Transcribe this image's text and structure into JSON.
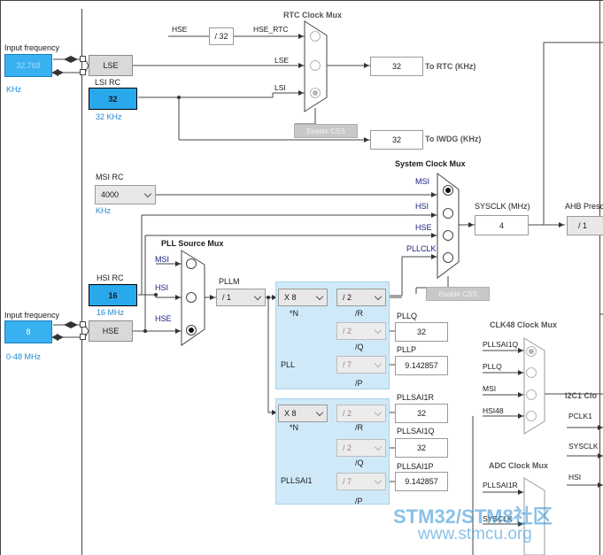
{
  "rtc_mux": {
    "title": "RTC Clock Mux",
    "input_hse": "HSE",
    "input_hse_rtc": "HSE_RTC",
    "input_lse": "LSE",
    "input_lsi": "LSI"
  },
  "hse_rtc_divider": "/ 32",
  "lse_input": {
    "label": "Input frequency",
    "value": "32.768",
    "unit": "KHz"
  },
  "lse_source": "LSE",
  "lsi_rc": {
    "label": "LSI RC",
    "value": "32",
    "unit": "32 KHz"
  },
  "rtc_output": {
    "value": "32",
    "label": "To RTC (KHz)"
  },
  "iwdg_output": {
    "value": "32",
    "label": "To IWDG (KHz)"
  },
  "enable_css_rtc": "Enable CSS",
  "msi_rc": {
    "label": "MSI RC",
    "value": "4000",
    "unit": "KHz"
  },
  "system_mux": {
    "title": "System Clock Mux",
    "inputs": [
      "MSI",
      "HSI",
      "HSE",
      "PLLCLK"
    ]
  },
  "sysclk": {
    "label": "SYSCLK (MHz)",
    "value": "4"
  },
  "ahb": {
    "label": "AHB Presc",
    "value": "/ 1"
  },
  "hsi_rc": {
    "label": "HSI RC",
    "value": "16",
    "unit": "16 MHz"
  },
  "hse_input": {
    "label": "Input frequency",
    "value": "8",
    "range": "0-48 MHz"
  },
  "hse_source": "HSE",
  "pll_source_mux": {
    "title": "PLL Source Mux",
    "inputs": [
      "MSI",
      "HSI",
      "HSE"
    ]
  },
  "pllm": {
    "label": "PLLM",
    "value": "/ 1"
  },
  "enable_css_sys": "Enable CSS",
  "pll": {
    "name": "PLL",
    "n_value": "X 8",
    "n_label": "*N",
    "r_value": "/ 2",
    "r_label": "/R",
    "q_value": "/ 2",
    "q_label": "/Q",
    "p_value": "/ 7",
    "p_label": "/P",
    "pllq_label": "PLLQ",
    "pllq_value": "32",
    "pllp_label": "PLLP",
    "pllp_value": "9.142857"
  },
  "pllsai1": {
    "name": "PLLSAI1",
    "n_value": "X 8",
    "n_label": "*N",
    "r_value": "/ 2",
    "r_label": "/R",
    "q_value": "/ 2",
    "q_label": "/Q",
    "p_value": "/ 7",
    "p_label": "/P",
    "r_out_label": "PLLSAI1R",
    "r_out_value": "32",
    "q_out_label": "PLLSAI1Q",
    "q_out_value": "32",
    "p_out_label": "PLLSAI1P",
    "p_out_value": "9.142857"
  },
  "clk48_mux": {
    "title": "CLK48 Clock Mux",
    "inputs": [
      "PLLSAI1Q",
      "PLLQ",
      "MSI",
      "HSI48"
    ]
  },
  "i2c1_mux": {
    "title": "I2C1 Clo",
    "inputs": [
      "PCLK1",
      "SYSCLK",
      "HSI"
    ]
  },
  "adc_mux": {
    "title": "ADC Clock Mux",
    "inputs": [
      "PLLSAI1R",
      "SYSCLK"
    ]
  },
  "watermark": {
    "brand": "STM32/STM8社区",
    "url": "www.stmcu.org"
  }
}
